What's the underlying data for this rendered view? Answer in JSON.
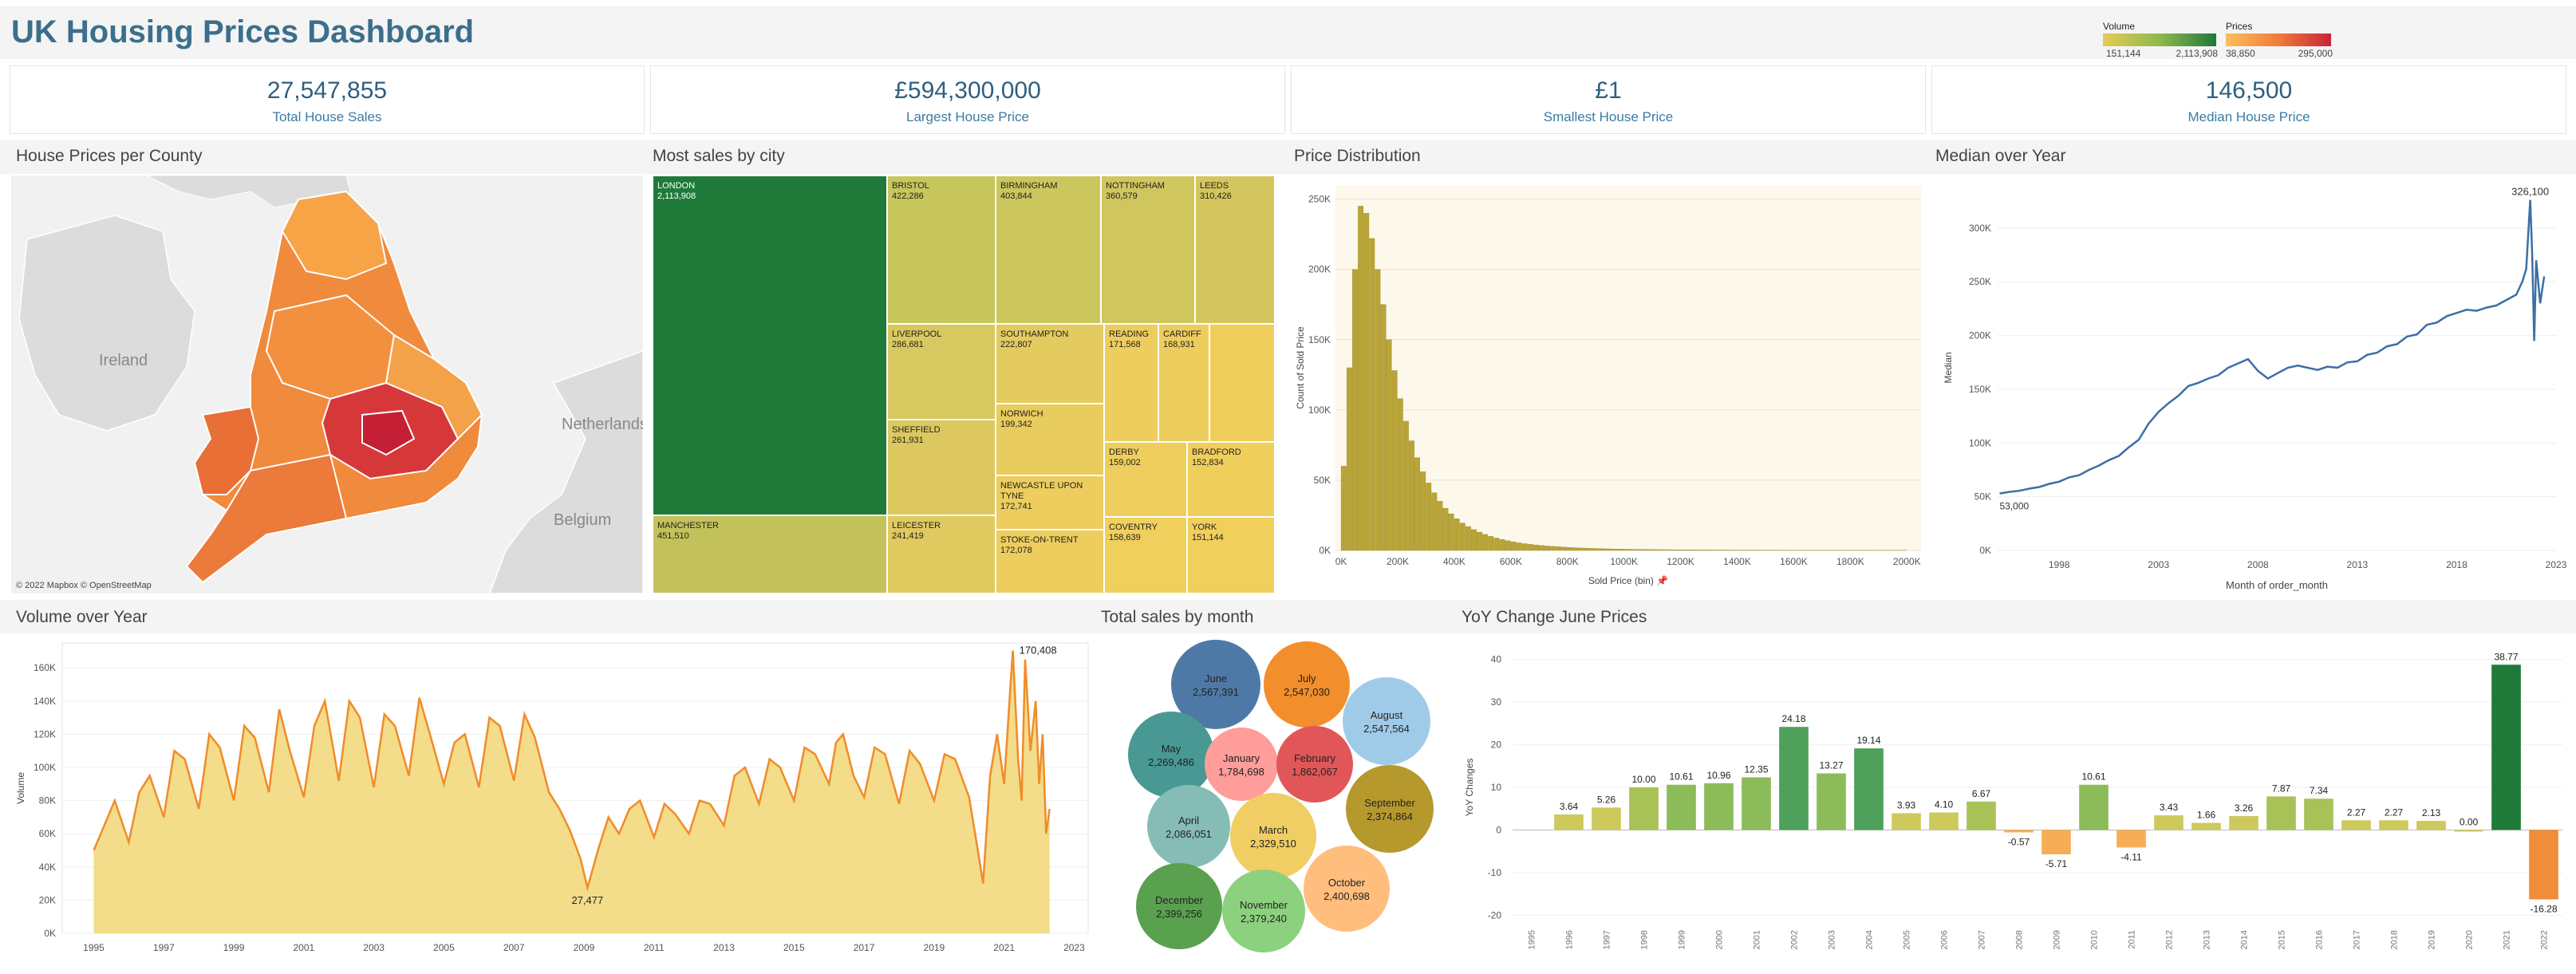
{
  "dashboard": {
    "title": "UK Housing Prices Dashboard",
    "legend": {
      "volume": {
        "label": "Volume",
        "min": "151,144",
        "max": "2,113,908"
      },
      "prices": {
        "label": "Prices",
        "min": "38,850",
        "max": "295,000"
      }
    }
  },
  "kpis": [
    {
      "value": "27,547,855",
      "label": "Total House Sales"
    },
    {
      "value": "£594,300,000",
      "label": "Largest House Price"
    },
    {
      "value": "£1",
      "label": "Smallest House Price"
    },
    {
      "value": "146,500",
      "label": "Median House Price"
    }
  ],
  "panels": {
    "map": {
      "title": "House Prices per County",
      "attribution": "© 2022 Mapbox © OpenStreetMap",
      "labels": [
        "Ireland",
        "Netherlands",
        "Belgium"
      ]
    },
    "treemap": {
      "title": "Most sales by city",
      "cities": [
        {
          "name": "LONDON",
          "value": "2,113,908"
        },
        {
          "name": "MANCHESTER",
          "value": "451,510"
        },
        {
          "name": "BRISTOL",
          "value": "422,286"
        },
        {
          "name": "BIRMINGHAM",
          "value": "403,844"
        },
        {
          "name": "NOTTINGHAM",
          "value": "360,579"
        },
        {
          "name": "LEEDS",
          "value": "310,426"
        },
        {
          "name": "LIVERPOOL",
          "value": "286,681"
        },
        {
          "name": "SOUTHAMPTON",
          "value": "222,807"
        },
        {
          "name": "READING",
          "value": "171,568"
        },
        {
          "name": "CARDIFF",
          "value": "168,931"
        },
        {
          "name": "SHEFFIELD",
          "value": "261,931"
        },
        {
          "name": "NORWICH",
          "value": "199,342"
        },
        {
          "name": "DERBY",
          "value": "159,002"
        },
        {
          "name": "BRADFORD",
          "value": "152,834"
        },
        {
          "name": "NEWCASTLE UPON TYNE",
          "value": "172,741"
        },
        {
          "name": "LEICESTER",
          "value": "241,419"
        },
        {
          "name": "COVENTRY",
          "value": "158,639"
        },
        {
          "name": "YORK",
          "value": "151,144"
        },
        {
          "name": "STOKE-ON-TRENT",
          "value": "172,078"
        }
      ]
    },
    "distribution": {
      "title": "Price Distribution",
      "xlabel": "Sold Price (bin) 📌",
      "ylabel": "Count of Sold Price",
      "xticks": [
        "0K",
        "200K",
        "400K",
        "600K",
        "800K",
        "1000K",
        "1200K",
        "1400K",
        "1600K",
        "1800K",
        "2000K"
      ],
      "yticks": [
        "0K",
        "50K",
        "100K",
        "150K",
        "200K",
        "250K"
      ]
    },
    "median": {
      "title": "Median over Year",
      "xlabel": "Month of order_month",
      "ylabel": "Median",
      "xticks": [
        "1998",
        "2003",
        "2008",
        "2013",
        "2018",
        "2023"
      ],
      "yticks": [
        "0K",
        "50K",
        "100K",
        "150K",
        "200K",
        "250K",
        "300K"
      ],
      "annot_start": "53,000",
      "annot_max": "326,100"
    },
    "volume": {
      "title": "Volume over Year",
      "ylabel": "Volume",
      "xticks": [
        "1995",
        "1997",
        "1999",
        "2001",
        "2003",
        "2005",
        "2007",
        "2009",
        "2011",
        "2013",
        "2015",
        "2017",
        "2019",
        "2021",
        "2023"
      ],
      "yticks": [
        "0K",
        "20K",
        "40K",
        "60K",
        "80K",
        "100K",
        "120K",
        "140K",
        "160K"
      ],
      "annot_min": "27,477",
      "annot_max": "170,408"
    },
    "months": {
      "title": "Total sales by month",
      "bubbles": [
        {
          "name": "June",
          "value": "2,567,391",
          "color": "#4e79a7"
        },
        {
          "name": "July",
          "value": "2,547,030",
          "color": "#f28e2b"
        },
        {
          "name": "August",
          "value": "2,547,564",
          "color": "#a0cbe8"
        },
        {
          "name": "May",
          "value": "2,269,486",
          "color": "#499894"
        },
        {
          "name": "January",
          "value": "1,784,698",
          "color": "#ff9d9a"
        },
        {
          "name": "February",
          "value": "1,862,067",
          "color": "#e15759"
        },
        {
          "name": "September",
          "value": "2,374,864",
          "color": "#b6992d"
        },
        {
          "name": "April",
          "value": "2,086,051",
          "color": "#86bcb6"
        },
        {
          "name": "March",
          "value": "2,329,510",
          "color": "#f1ce63"
        },
        {
          "name": "October",
          "value": "2,400,698",
          "color": "#ffbe7d"
        },
        {
          "name": "December",
          "value": "2,399,256",
          "color": "#59a14f"
        },
        {
          "name": "November",
          "value": "2,379,240",
          "color": "#8cd17d"
        }
      ]
    },
    "yoy": {
      "title": "YoY Change June Prices",
      "ylabel": "YoY Changes",
      "yticks": [
        "-20",
        "-10",
        "0",
        "10",
        "20",
        "30",
        "40"
      ]
    }
  },
  "chart_data": [
    {
      "type": "bar",
      "title": "Price Distribution",
      "xlabel": "Sold Price (bin)",
      "ylabel": "Count of Sold Price",
      "bin_width_k": 20,
      "x_start_k": 0,
      "ylim": [
        0,
        260000
      ],
      "xlim_k": [
        -20,
        2050
      ],
      "values": [
        60000,
        130000,
        200000,
        245000,
        240000,
        222000,
        200000,
        175000,
        150000,
        128000,
        108000,
        92000,
        78000,
        66000,
        56000,
        48000,
        41000,
        35000,
        30000,
        26000,
        22500,
        19500,
        17000,
        14800,
        13000,
        11400,
        10000,
        8800,
        7800,
        6900,
        6100,
        5400,
        4800,
        4300,
        3900,
        3500,
        3150,
        2850,
        2580,
        2340,
        2120,
        1920,
        1740,
        1580,
        1440,
        1310,
        1200,
        1100,
        1010,
        930,
        860,
        800,
        740,
        690,
        640,
        600,
        560,
        525,
        495,
        465,
        440,
        415,
        392,
        370,
        350,
        332,
        315,
        300,
        285,
        272,
        260,
        248,
        237,
        227,
        218,
        209,
        201,
        193,
        186,
        179,
        173,
        167,
        161,
        156,
        151,
        146,
        142,
        138,
        134,
        130,
        127,
        124,
        121,
        118,
        115,
        112,
        109,
        106,
        104,
        102
      ]
    },
    {
      "type": "line",
      "title": "Median over Year",
      "xlabel": "Month of order_month",
      "ylabel": "Median",
      "ylim": [
        0,
        340000
      ],
      "xlim": [
        1994.9,
        2023
      ],
      "x": [
        1995.0,
        1995.5,
        1996.0,
        1996.5,
        1997.0,
        1997.5,
        1998.0,
        1998.5,
        1999.0,
        1999.5,
        2000.0,
        2000.5,
        2001.0,
        2001.5,
        2002.0,
        2002.5,
        2003.0,
        2003.5,
        2004.0,
        2004.5,
        2005.0,
        2005.5,
        2006.0,
        2006.5,
        2007.0,
        2007.5,
        2008.0,
        2008.5,
        2009.0,
        2009.5,
        2010.0,
        2010.5,
        2011.0,
        2011.5,
        2012.0,
        2012.5,
        2013.0,
        2013.5,
        2014.0,
        2014.5,
        2015.0,
        2015.5,
        2016.0,
        2016.5,
        2017.0,
        2017.5,
        2018.0,
        2018.5,
        2019.0,
        2019.5,
        2020.0,
        2020.5,
        2021.0,
        2021.3,
        2021.5,
        2021.7,
        2021.8,
        2021.9,
        2022.0,
        2022.2,
        2022.4
      ],
      "y": [
        53000,
        54500,
        55500,
        57500,
        59000,
        62000,
        64000,
        68000,
        70000,
        75000,
        79000,
        84000,
        88000,
        96000,
        103000,
        118000,
        129000,
        137000,
        144000,
        153000,
        156000,
        160000,
        163000,
        170000,
        174000,
        178000,
        167000,
        160000,
        165000,
        170000,
        172000,
        170000,
        168000,
        171000,
        170000,
        175000,
        176000,
        182000,
        184000,
        190000,
        192000,
        199000,
        201000,
        210000,
        212000,
        218000,
        221000,
        224000,
        223000,
        226000,
        228000,
        233000,
        238000,
        250000,
        262000,
        326100,
        275000,
        195000,
        270000,
        230000,
        255000
      ],
      "annotations": [
        "53,000",
        "326,100"
      ]
    },
    {
      "type": "area",
      "title": "Volume over Year",
      "ylabel": "Volume",
      "ylim": [
        0,
        175000
      ],
      "xlim": [
        1994.1,
        2023.4
      ],
      "x": [
        1995.0,
        1995.3,
        1995.6,
        1996.0,
        1996.3,
        1996.6,
        1997.0,
        1997.3,
        1997.6,
        1998.0,
        1998.3,
        1998.6,
        1999.0,
        1999.3,
        1999.6,
        2000.0,
        2000.3,
        2000.6,
        2001.0,
        2001.3,
        2001.6,
        2002.0,
        2002.3,
        2002.6,
        2003.0,
        2003.3,
        2003.6,
        2004.0,
        2004.3,
        2004.6,
        2005.0,
        2005.3,
        2005.6,
        2006.0,
        2006.3,
        2006.6,
        2007.0,
        2007.3,
        2007.6,
        2008.0,
        2008.3,
        2008.6,
        2008.9,
        2009.1,
        2009.4,
        2009.7,
        2010.0,
        2010.3,
        2010.6,
        2011.0,
        2011.3,
        2011.6,
        2012.0,
        2012.3,
        2012.6,
        2013.0,
        2013.3,
        2013.6,
        2014.0,
        2014.3,
        2014.6,
        2015.0,
        2015.3,
        2015.6,
        2016.0,
        2016.2,
        2016.4,
        2016.7,
        2017.0,
        2017.3,
        2017.6,
        2018.0,
        2018.3,
        2018.6,
        2019.0,
        2019.3,
        2019.6,
        2020.0,
        2020.25,
        2020.4,
        2020.6,
        2020.8,
        2021.0,
        2021.2,
        2021.25,
        2021.4,
        2021.5,
        2021.6,
        2021.75,
        2021.9,
        2022.0,
        2022.1,
        2022.2,
        2022.3
      ],
      "y": [
        50000,
        65000,
        80000,
        55000,
        85000,
        95000,
        70000,
        110000,
        105000,
        75000,
        120000,
        112000,
        80000,
        125000,
        118000,
        85000,
        135000,
        110000,
        82000,
        125000,
        140000,
        92000,
        140000,
        130000,
        88000,
        132000,
        125000,
        95000,
        142000,
        120000,
        90000,
        115000,
        120000,
        88000,
        130000,
        125000,
        92000,
        132000,
        118000,
        85000,
        75000,
        62000,
        45000,
        27477,
        50000,
        70000,
        60000,
        75000,
        80000,
        58000,
        78000,
        72000,
        60000,
        80000,
        78000,
        65000,
        95000,
        100000,
        78000,
        105000,
        100000,
        80000,
        112000,
        108000,
        90000,
        115000,
        120000,
        95000,
        82000,
        112000,
        108000,
        78000,
        110000,
        102000,
        80000,
        108000,
        105000,
        82000,
        50000,
        30000,
        95000,
        120000,
        90000,
        155000,
        170408,
        105000,
        80000,
        165000,
        110000,
        140000,
        90000,
        120000,
        60000,
        75000
      ],
      "annotations": [
        "27,477",
        "170,408"
      ]
    },
    {
      "type": "bar",
      "title": "YoY Change June Prices",
      "ylabel": "YoY Changes",
      "ylim": [
        -22,
        42
      ],
      "categories": [
        "1995",
        "1996",
        "1997",
        "1998",
        "1999",
        "2000",
        "2001",
        "2002",
        "2003",
        "2004",
        "2005",
        "2006",
        "2007",
        "2008",
        "2009",
        "2010",
        "2011",
        "2012",
        "2013",
        "2014",
        "2015",
        "2016",
        "2017",
        "2018",
        "2019",
        "2020",
        "2021",
        "2022"
      ],
      "values": [
        null,
        3.64,
        5.26,
        10.0,
        10.61,
        10.96,
        12.35,
        24.18,
        13.27,
        19.14,
        3.93,
        4.1,
        6.67,
        -0.57,
        -5.71,
        10.61,
        -4.11,
        3.43,
        1.66,
        3.26,
        7.87,
        7.34,
        2.27,
        2.27,
        2.13,
        0.0,
        38.77,
        -16.28
      ],
      "labels": [
        "",
        "3.64",
        "5.26",
        "10.00",
        "10.61",
        "10.96",
        "12.35",
        "24.18",
        "13.27",
        "19.14",
        "3.93",
        "4.10",
        "6.67",
        "-0.57",
        "-5.71",
        "10.61",
        "-4.11",
        "3.43",
        "1.66",
        "3.26",
        "7.87",
        "7.34",
        "2.27",
        "2.27",
        "2.13",
        "0.00",
        "38.77",
        "-16.28"
      ]
    }
  ]
}
